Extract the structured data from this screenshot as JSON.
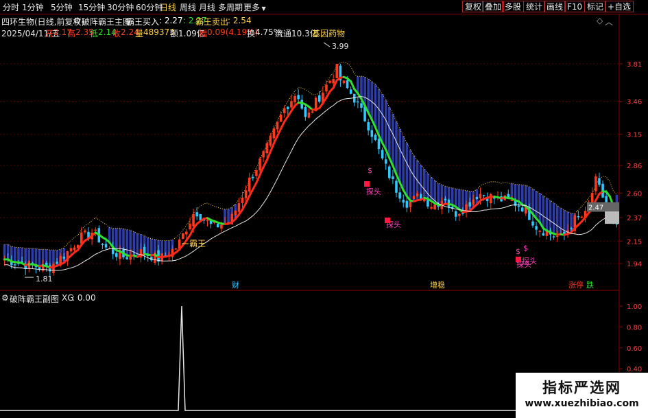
{
  "toolbar": {
    "timeframes": [
      "分时",
      "1分钟",
      "5分钟",
      "15分钟",
      "30分钟",
      "60分钟",
      "日线",
      "周线",
      "月线",
      "多周期",
      "更多"
    ],
    "active_timeframe": "日线",
    "buttons": [
      "复权",
      "叠加",
      "多股",
      "统计",
      "画线",
      "F10",
      "标记",
      "+自选"
    ]
  },
  "main_header": {
    "stock_title": "四环生物(日线,前复权)",
    "indicator_name": "破阵霸王主图",
    "buy_label": "霸王买入",
    "buy_value": ": 2.27",
    "buy_value2": ": 2.27",
    "sell_label": "霸王卖出",
    "sell_value": ": 2.54"
  },
  "quote": {
    "date": "2025/04/11/五",
    "open_label": "开",
    "open": "2.17",
    "high_label": "高",
    "high": "2.35",
    "low_label": "低",
    "low": "2.14",
    "close_label": "收",
    "close": "2.24",
    "volume_label": "量",
    "volume": "489373",
    "amount_label": "额",
    "amount": "1.09亿",
    "change_label": "幅",
    "change": "0.09(4.19%)",
    "turnover_label": "换",
    "turnover": "4.75%",
    "float_label": "流通",
    "float": "10.3亿",
    "sector": "基因药物"
  },
  "price_axis": [
    "3.81",
    "3.46",
    "3.15",
    "2.86",
    "2.60",
    "2.37",
    "2.15",
    "1.94"
  ],
  "price_tag": "2.47",
  "chart_data": {
    "type": "candlestick",
    "ylim": [
      1.81,
      3.99
    ],
    "x_count": 176,
    "annotations": {
      "high_label": "3.99",
      "low_label": "1.81",
      "bawang_label": "霸王",
      "tantou_label": "探头",
      "dollar_label": "$",
      "event_labels": [
        "财",
        "增稳",
        "涨停",
        "跌"
      ]
    }
  },
  "sub_header": {
    "indicator_name": "破阵霸王副图",
    "xg_label": "XG",
    "xg_value": ": 0.00"
  },
  "sub_axis": [
    "1.00",
    "0.80",
    "0.60",
    "0.40",
    "0.20"
  ],
  "watermark": {
    "title": "指标严选网",
    "url": "www.xuezhibiao.com"
  },
  "colors": {
    "up": "#ff3a1e",
    "down": "#2dc8ff",
    "ma_up": "#ff2a1a",
    "ma_down": "#30e030",
    "slow_ma": "#e8e8e8",
    "band": "#2e3ca8",
    "band_edge": "#ffd24a",
    "axis_line": "#8b0000"
  }
}
